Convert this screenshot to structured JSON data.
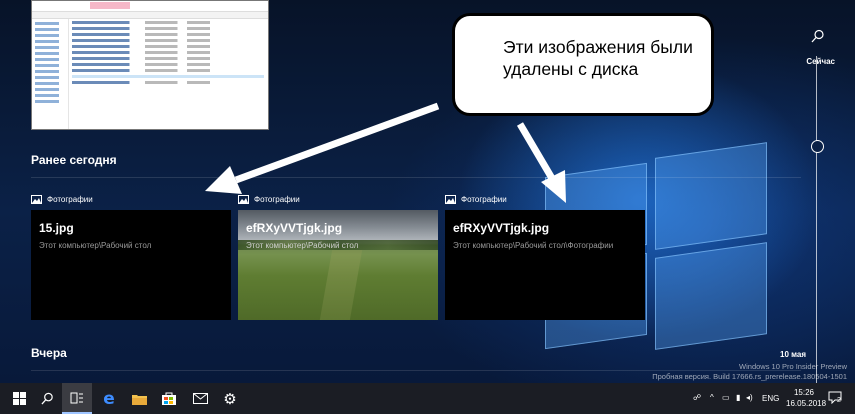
{
  "thumbnail": {
    "label": "File Explorer"
  },
  "sections": {
    "earlier_today": "Ранее сегодня",
    "yesterday": "Вчера"
  },
  "cards": [
    {
      "app": "Фотографии",
      "name": "15.jpg",
      "path": "Этот компьютер\\Рабочий стол",
      "kind": "dark"
    },
    {
      "app": "Фотографии",
      "name": "efRXyVVTjgk.jpg",
      "path": "Этот компьютер\\Рабочий стол",
      "kind": "photo"
    },
    {
      "app": "Фотографии",
      "name": "efRXyVVTjgk.jpg",
      "path": "Этот компьютер\\Рабочий стол\\Фотографии",
      "kind": "dark"
    }
  ],
  "callout": {
    "text": "Эти изображения были удалены с диска"
  },
  "timeline": {
    "now": "Сейчас",
    "date": "10 мая"
  },
  "watermark": {
    "line1": "Windows 10 Pro Insider Preview",
    "line2": "Пробная версия. Build 17666.rs_prerelease.180504-1501"
  },
  "taskbar": {
    "buttons": [
      "windows-start",
      "search",
      "task-view",
      "edge",
      "file-explorer",
      "store",
      "mail",
      "settings"
    ],
    "tray": {
      "lang": "ENG",
      "time": "15:26",
      "date": "16.05.2018",
      "notifications": "2"
    }
  },
  "colors": {
    "accent": "#9ec4ff",
    "taskbar": "#1b1d24",
    "card": "#000000"
  }
}
